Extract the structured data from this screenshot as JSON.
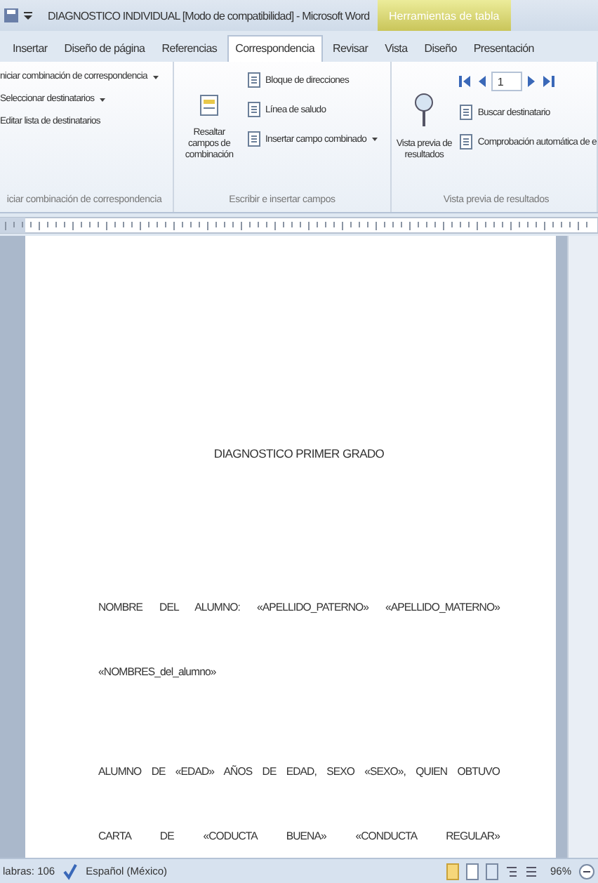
{
  "window": {
    "title": "DIAGNOSTICO INDIVIDUAL [Modo de compatibilidad] - Microsoft Word",
    "contextual_tab": "Herramientas de tabla"
  },
  "tabs": [
    {
      "label": "Insertar",
      "selected": false
    },
    {
      "label": "Diseño de página",
      "selected": false
    },
    {
      "label": "Referencias",
      "selected": false
    },
    {
      "label": "Correspondencia",
      "selected": true
    },
    {
      "label": "Revisar",
      "selected": false
    },
    {
      "label": "Vista",
      "selected": false
    },
    {
      "label": "Diseño",
      "selected": false
    },
    {
      "label": "Presentación",
      "selected": false
    }
  ],
  "ribbon": {
    "groups": [
      {
        "label": "iciar combinación de correspondencia",
        "items": [
          {
            "kind": "plain",
            "label": "niciar combinación de correspondencia",
            "dropdown": true
          },
          {
            "kind": "plain",
            "label": "Seleccionar destinatarios",
            "dropdown": true
          },
          {
            "kind": "plain",
            "label": "Editar lista de destinatarios",
            "dropdown": false
          }
        ]
      },
      {
        "label": "Escribir e insertar campos",
        "items": [
          {
            "kind": "large",
            "label": "Resaltar campos de combinación"
          },
          {
            "kind": "small",
            "label": "Bloque de direcciones",
            "dropdown": false
          },
          {
            "kind": "small",
            "label": "Línea de saludo",
            "dropdown": false
          },
          {
            "kind": "small",
            "label": "Insertar campo combinado",
            "dropdown": true
          }
        ]
      },
      {
        "label": "Vista previa de resultados",
        "items": [
          {
            "kind": "large",
            "label": "Vista previa de resultados"
          },
          {
            "kind": "nav",
            "value": "1"
          },
          {
            "kind": "small",
            "label": "Buscar destinatario",
            "dropdown": false
          },
          {
            "kind": "small",
            "label": "Comprobación automática de e",
            "dropdown": false
          }
        ]
      }
    ]
  },
  "document": {
    "heading": "DIAGNOSTICO PRIMER GRADO",
    "paragraphs": [
      {
        "lines": [
          "NOMBRE DEL ALUMNO: «APELLIDO_PATERNO» «APELLIDO_MATERNO»",
          "«NOMBRES_del_alumno»"
        ]
      },
      {
        "lines": [
          "ALUMNO DE «EDAD» AÑOS DE EDAD, SEXO «SEXO», QUIEN OBTUVO",
          "CARTA DE «CODUCTA BUENA» «CONDUCTA REGULAR»"
        ]
      }
    ]
  },
  "status_bar": {
    "words": "labras: 106",
    "language": "Español (México)",
    "zoom": "96%"
  }
}
